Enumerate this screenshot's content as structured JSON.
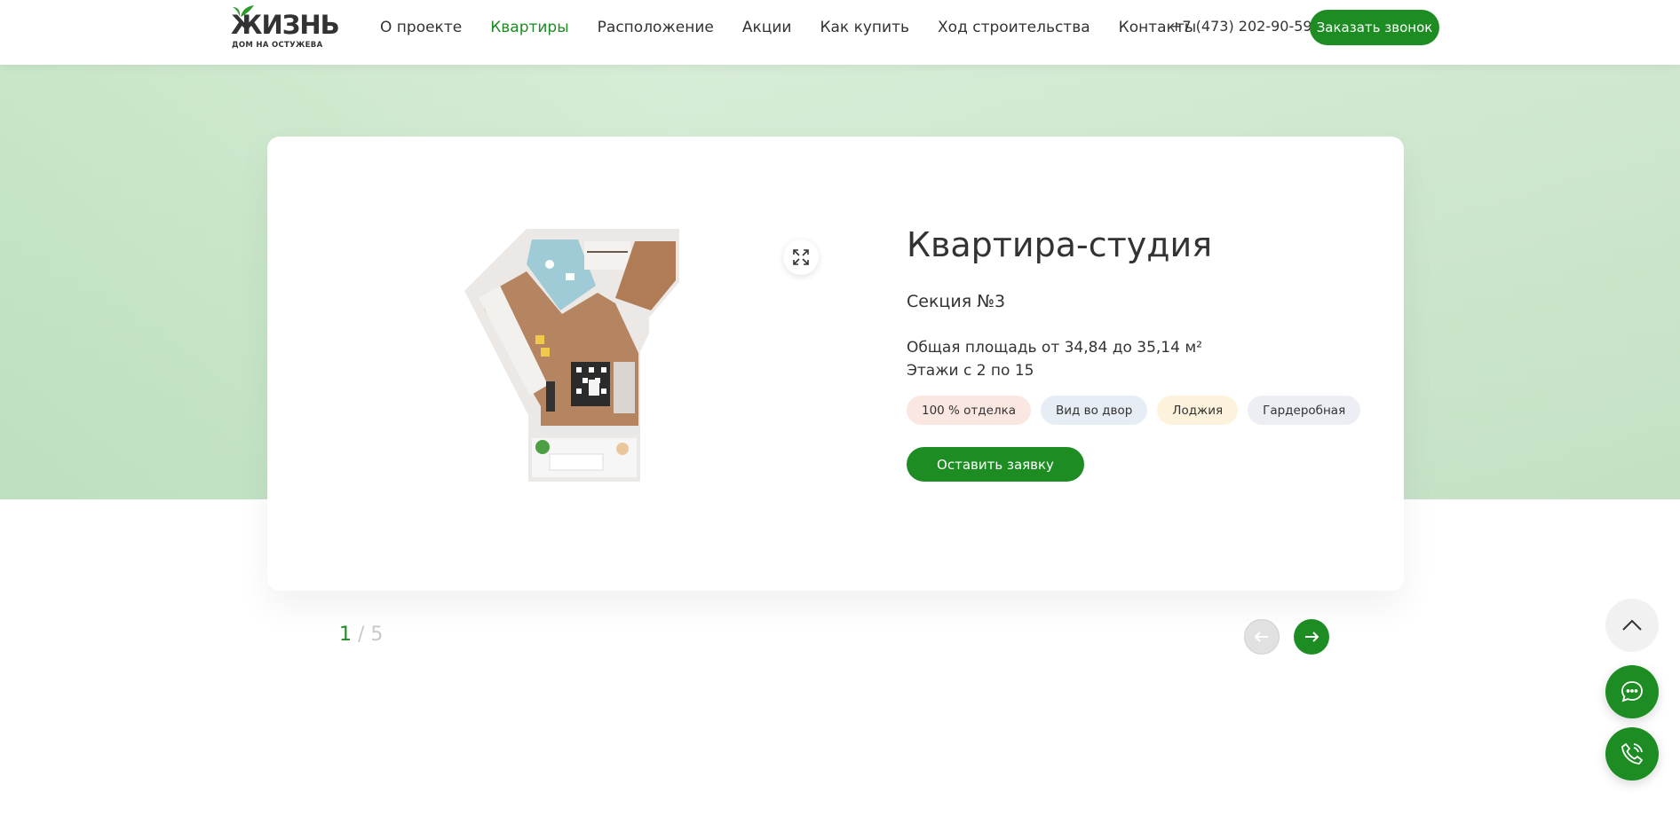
{
  "header": {
    "logo_word": "ЖИЗНЬ",
    "logo_sub": "ДОМ НА ОСТУЖЕВА",
    "nav": [
      {
        "label": "О проекте",
        "active": false
      },
      {
        "label": "Квартиры",
        "active": true
      },
      {
        "label": "Расположение",
        "active": false
      },
      {
        "label": "Акции",
        "active": false
      },
      {
        "label": "Как купить",
        "active": false
      },
      {
        "label": "Ход строительства",
        "active": false
      },
      {
        "label": "Контакты",
        "active": false
      }
    ],
    "phone": "+7 (473) 202-90-59",
    "call_button": "Заказать звонок"
  },
  "card": {
    "title": "Квартира-студия",
    "section": "Секция №3",
    "area": "Общая площадь от 34,84 до 35,14 м²",
    "floors": "Этажи с 2 по 15",
    "tags": [
      {
        "label": "100 % отделка",
        "color": "#fbe7e1"
      },
      {
        "label": "Вид во двор",
        "color": "#e6edf5"
      },
      {
        "label": "Лоджия",
        "color": "#fdf3dc"
      },
      {
        "label": "Гардеробная",
        "color": "#eceef4"
      }
    ],
    "request_button": "Оставить заявку"
  },
  "pager": {
    "current": "1",
    "separator": "/",
    "total": "5"
  },
  "colors": {
    "accent": "#1d8d23",
    "banner": "#d0e8d0"
  }
}
